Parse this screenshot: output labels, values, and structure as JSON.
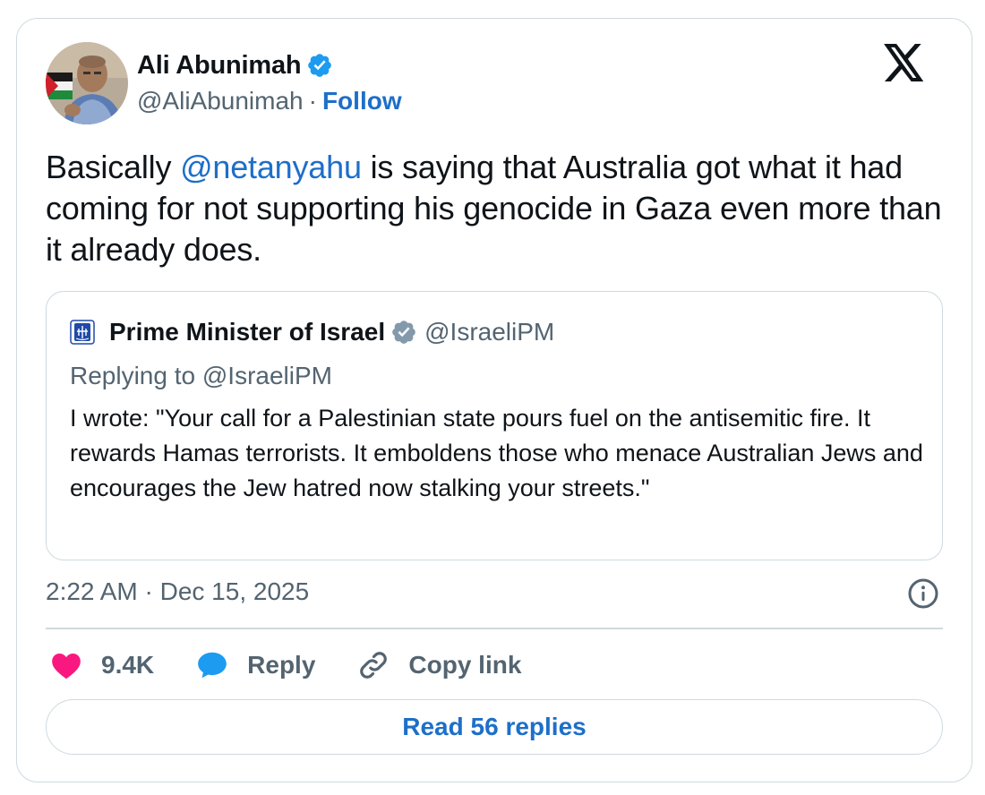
{
  "author": {
    "name": "Ali Abunimah",
    "handle": "@AliAbunimah",
    "separator": "·",
    "follow_label": "Follow"
  },
  "tweet": {
    "text_before": "Basically ",
    "mention": "@netanyahu",
    "text_after": " is saying that Australia got what it had coming for not supporting his genocide in Gaza even more than it already does."
  },
  "quoted": {
    "name": "Prime Minister of Israel",
    "handle": "@IsraeliPM",
    "replying_to": "Replying to @IsraeliPM",
    "text": "I wrote: \"Your call for a Palestinian state pours fuel on the antisemitic fire. It rewards Hamas terrorists. It emboldens those who menace Australian Jews and encourages the Jew hatred now stalking your streets.\""
  },
  "timestamp": "2:22 AM · Dec 15, 2025",
  "actions": {
    "like_count": "9.4K",
    "reply_label": "Reply",
    "copy_label": "Copy link"
  },
  "read_replies_label": "Read 56 replies",
  "icons": {
    "verified": "verified-badge-icon",
    "x_logo": "x-logo-icon",
    "like": "heart-icon",
    "reply": "speech-bubble-icon",
    "copy": "link-icon",
    "info": "info-icon"
  },
  "colors": {
    "accent": "#1d6fc9",
    "verified_blue": "#1d9bf0",
    "verified_gray": "#829aab",
    "like_pink": "#f91880",
    "muted": "#536471",
    "border": "#cfd9de"
  }
}
